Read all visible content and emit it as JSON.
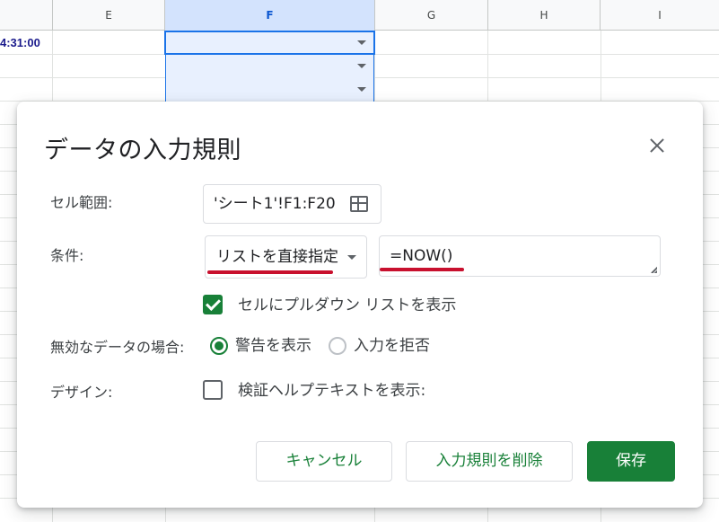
{
  "sheet": {
    "columns": [
      {
        "label": "",
        "selected": false
      },
      {
        "label": "E",
        "selected": false
      },
      {
        "label": "F",
        "selected": true
      },
      {
        "label": "G",
        "selected": false
      },
      {
        "label": "H",
        "selected": false
      },
      {
        "label": "I",
        "selected": false
      }
    ],
    "partial_cell_value": "4:31:00"
  },
  "dialog": {
    "title": "データの入力規則",
    "cell_range": {
      "label": "セル範囲:",
      "value": "'シート1'!F1:F20",
      "icon": "grid-icon"
    },
    "criteria": {
      "label": "条件:",
      "type_value": "リストを直接指定",
      "formula_value": "=NOW()"
    },
    "show_dropdown": {
      "label": "セルにプルダウン リストを表示",
      "checked": true
    },
    "invalid_data": {
      "label": "無効なデータの場合:",
      "options": [
        {
          "label": "警告を表示",
          "selected": true
        },
        {
          "label": "入力を拒否",
          "selected": false
        }
      ]
    },
    "appearance": {
      "label": "デザイン:",
      "help_text_label": "検証ヘルプテキストを表示:",
      "checked": false
    },
    "buttons": {
      "cancel": "キャンセル",
      "remove": "入力規則を削除",
      "save": "保存"
    }
  },
  "colors": {
    "accent_green": "#188038",
    "selection_blue": "#1a73e8",
    "annotation_red": "#c8102e"
  }
}
